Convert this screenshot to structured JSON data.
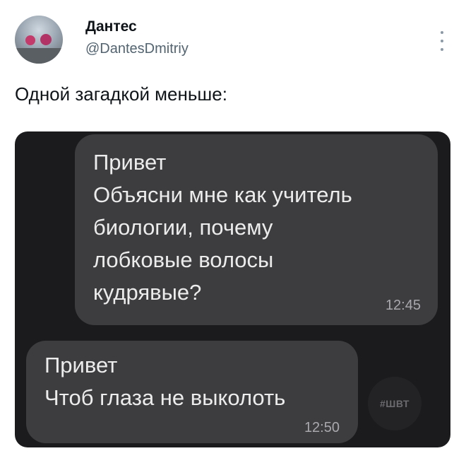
{
  "tweet": {
    "author_name": "Дантес",
    "author_handle": "@DantesDmitriy",
    "text": "Одной загадкой меньше:",
    "more_icon": "three-dots-vertical-icon"
  },
  "chat": {
    "messages": [
      {
        "lines": [
          "Привет",
          "Объясни мне как учитель",
          "биологии, почему",
          "лобковые волосы",
          "кудрявые?"
        ],
        "time": "12:45",
        "direction": "outgoing"
      },
      {
        "lines": [
          "Привет",
          "Чтоб глаза не выколоть"
        ],
        "time": "12:50",
        "direction": "incoming"
      }
    ],
    "watermark": "#ШВТ"
  },
  "colors": {
    "chat_background": "#1b1b1d",
    "bubble": "#3d3d40",
    "handle": "#536471"
  }
}
